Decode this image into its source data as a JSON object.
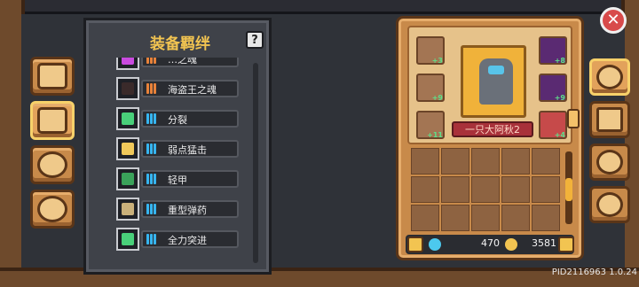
{
  "bond_panel": {
    "title": "装备羁绊",
    "help_label": "?",
    "rows": [
      {
        "name": "…之魂",
        "icon": "potion-icon",
        "icon_color": "#c94adf",
        "bar_color": "#e8823a",
        "bars": 3
      },
      {
        "name": "海盗王之魂",
        "icon": "bomb-icon",
        "icon_color": "#3a2a2a",
        "bar_color": "#e8823a",
        "bars": 3
      },
      {
        "name": "分裂",
        "icon": "split-arrows-icon",
        "icon_color": "#49d07a",
        "bar_color": "#36b5f0",
        "bars": 3
      },
      {
        "name": "弱点猛击",
        "icon": "slash-icon",
        "icon_color": "#f0c85a",
        "bar_color": "#36b5f0",
        "bars": 3
      },
      {
        "name": "轻甲",
        "icon": "light-armor-icon",
        "icon_color": "#3aa25a",
        "bar_color": "#36b5f0",
        "bars": 3
      },
      {
        "name": "重型弹药",
        "icon": "heavy-ammo-icon",
        "icon_color": "#c9b07a",
        "bar_color": "#36b5f0",
        "bars": 3
      },
      {
        "name": "全力突进",
        "icon": "dash-icon",
        "icon_color": "#49d07a",
        "bar_color": "#36b5f0",
        "bars": 3
      }
    ]
  },
  "equipment": {
    "hero_name": "一只大阿秋2",
    "slots_left": [
      {
        "icon": "helmet-icon",
        "level": "+3"
      },
      {
        "icon": "necklace-icon",
        "level": "+9"
      },
      {
        "icon": "armor-icon",
        "level": "+11"
      }
    ],
    "slots_right": [
      {
        "icon": "purple-bag-icon",
        "level": "+8"
      },
      {
        "icon": "purple-boots-icon",
        "level": "+9"
      },
      {
        "icon": "rifle-icon",
        "level": "+4"
      }
    ]
  },
  "currency": {
    "gems": "470",
    "coins": "3581"
  },
  "version": "PID2116963 1.0.24",
  "left_tabs": [
    "book-icon",
    "bond-icon",
    "flower-icon",
    "steering-wheel-icon"
  ],
  "right_tabs": [
    "mask-icon",
    "tools-icon",
    "gear-burst-icon",
    "settings-gear-icon"
  ],
  "close_label": "✕"
}
